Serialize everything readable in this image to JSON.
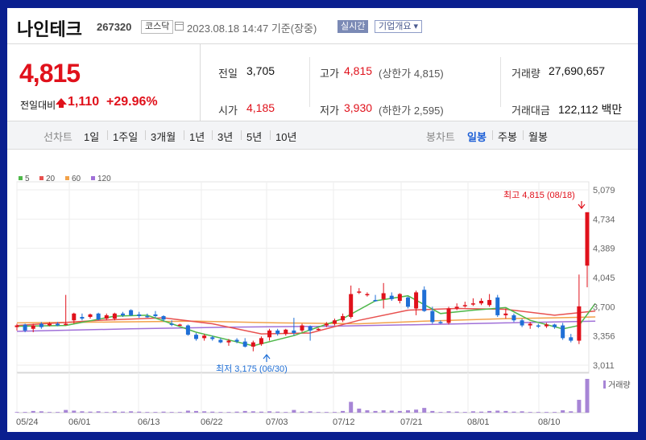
{
  "header": {
    "name": "나인테크",
    "code": "267320",
    "market": "코스닥",
    "datetime": "2023.08.18 14:47 기준(장중)",
    "realtime": "실시간",
    "overview": "기업개요 ▾"
  },
  "quote": {
    "price": "4,815",
    "change_label": "전일대비",
    "change": "1,110",
    "change_pct": "+29.96%",
    "prev_close_label": "전일",
    "prev_close": "3,705",
    "open_label": "시가",
    "open": "4,185",
    "high_label": "고가",
    "high": "4,815",
    "upper_limit": "(상한가 4,815)",
    "low_label": "저가",
    "low": "3,930",
    "lower_limit": "(하한가 2,595)",
    "volume_label": "거래량",
    "volume": "27,690,657",
    "amount_label": "거래대금",
    "amount": "122,112 백만"
  },
  "period_tabs": {
    "line_chart": "선차트",
    "items": [
      "1일",
      "1주일",
      "3개월",
      "1년",
      "3년",
      "5년",
      "10년"
    ],
    "candle_chart": "봉차트",
    "candle_items": [
      "일봉",
      "주봉",
      "월봉"
    ],
    "active": "일봉"
  },
  "colors": {
    "up": "#e0111b",
    "down": "#1f6fd6",
    "ma5": "#4fb84a",
    "ma20": "#e8514f",
    "ma60": "#f2a24a",
    "ma120": "#a070d8"
  },
  "chart_data": {
    "type": "candlestick",
    "legend": [
      {
        "name": "5",
        "color": "#4fb84a"
      },
      {
        "name": "20",
        "color": "#e8514f"
      },
      {
        "name": "60",
        "color": "#f2a24a"
      },
      {
        "name": "120",
        "color": "#a070d8"
      }
    ],
    "y_ticks": [
      "5,079",
      "4,734",
      "4,389",
      "4,045",
      "3,700",
      "3,356",
      "3,011"
    ],
    "ylim": [
      3011,
      5079
    ],
    "x_ticks": [
      "05/24",
      "06/01",
      "06/13",
      "06/22",
      "07/03",
      "07/12",
      "07/21",
      "08/01",
      "08/10"
    ],
    "volume_label": "거래량",
    "annotations": {
      "high": "최고 4,815 (08/18)",
      "low": "최저 3,175 (06/30)"
    },
    "candles": [
      {
        "o": 3460,
        "h": 3500,
        "l": 3420,
        "c": 3480,
        "v": 0.02
      },
      {
        "o": 3490,
        "h": 3500,
        "l": 3400,
        "c": 3420,
        "v": 0.02
      },
      {
        "o": 3440,
        "h": 3500,
        "l": 3400,
        "c": 3480,
        "v": 0.05
      },
      {
        "o": 3500,
        "h": 3520,
        "l": 3440,
        "c": 3460,
        "v": 0.04
      },
      {
        "o": 3480,
        "h": 3520,
        "l": 3470,
        "c": 3500,
        "v": 0.02
      },
      {
        "o": 3500,
        "h": 3520,
        "l": 3470,
        "c": 3480,
        "v": 0.02
      },
      {
        "o": 3490,
        "h": 3840,
        "l": 3480,
        "c": 3500,
        "v": 0.08
      },
      {
        "o": 3540,
        "h": 3630,
        "l": 3500,
        "c": 3620,
        "v": 0.06
      },
      {
        "o": 3580,
        "h": 3620,
        "l": 3540,
        "c": 3560,
        "v": 0.04
      },
      {
        "o": 3580,
        "h": 3620,
        "l": 3560,
        "c": 3610,
        "v": 0.03
      },
      {
        "o": 3620,
        "h": 3630,
        "l": 3540,
        "c": 3550,
        "v": 0.04
      },
      {
        "o": 3560,
        "h": 3620,
        "l": 3540,
        "c": 3600,
        "v": 0.02
      },
      {
        "o": 3560,
        "h": 3630,
        "l": 3540,
        "c": 3620,
        "v": 0.04
      },
      {
        "o": 3620,
        "h": 3640,
        "l": 3580,
        "c": 3600,
        "v": 0.03
      },
      {
        "o": 3660,
        "h": 3670,
        "l": 3590,
        "c": 3600,
        "v": 0.04
      },
      {
        "o": 3610,
        "h": 3640,
        "l": 3570,
        "c": 3590,
        "v": 0.03
      },
      {
        "o": 3590,
        "h": 3620,
        "l": 3570,
        "c": 3580,
        "v": 0.02
      },
      {
        "o": 3610,
        "h": 3650,
        "l": 3570,
        "c": 3590,
        "v": 0.02
      },
      {
        "o": 3590,
        "h": 3600,
        "l": 3530,
        "c": 3550,
        "v": 0.03
      },
      {
        "o": 3500,
        "h": 3540,
        "l": 3470,
        "c": 3490,
        "v": 0.02
      },
      {
        "o": 3490,
        "h": 3500,
        "l": 3480,
        "c": 3490,
        "v": 0.02
      },
      {
        "o": 3480,
        "h": 3490,
        "l": 3360,
        "c": 3370,
        "v": 0.06
      },
      {
        "o": 3370,
        "h": 3390,
        "l": 3300,
        "c": 3320,
        "v": 0.05
      },
      {
        "o": 3330,
        "h": 3380,
        "l": 3300,
        "c": 3360,
        "v": 0.04
      },
      {
        "o": 3340,
        "h": 3360,
        "l": 3300,
        "c": 3320,
        "v": 0.03
      },
      {
        "o": 3310,
        "h": 3330,
        "l": 3270,
        "c": 3280,
        "v": 0.02
      },
      {
        "o": 3280,
        "h": 3320,
        "l": 3240,
        "c": 3300,
        "v": 0.02
      },
      {
        "o": 3310,
        "h": 3330,
        "l": 3270,
        "c": 3290,
        "v": 0.03
      },
      {
        "o": 3290,
        "h": 3330,
        "l": 3220,
        "c": 3230,
        "v": 0.05
      },
      {
        "o": 3230,
        "h": 3300,
        "l": 3175,
        "c": 3280,
        "v": 0.04
      },
      {
        "o": 3260,
        "h": 3350,
        "l": 3240,
        "c": 3330,
        "v": 0.03
      },
      {
        "o": 3340,
        "h": 3440,
        "l": 3300,
        "c": 3420,
        "v": 0.04
      },
      {
        "o": 3420,
        "h": 3440,
        "l": 3360,
        "c": 3380,
        "v": 0.03
      },
      {
        "o": 3380,
        "h": 3440,
        "l": 3360,
        "c": 3430,
        "v": 0.02
      },
      {
        "o": 3420,
        "h": 3570,
        "l": 3360,
        "c": 3390,
        "v": 0.08
      },
      {
        "o": 3420,
        "h": 3500,
        "l": 3400,
        "c": 3480,
        "v": 0.03
      },
      {
        "o": 3470,
        "h": 3480,
        "l": 3300,
        "c": 3420,
        "v": 0.04
      },
      {
        "o": 3430,
        "h": 3450,
        "l": 3420,
        "c": 3440,
        "v": 0.02
      },
      {
        "o": 3480,
        "h": 3520,
        "l": 3460,
        "c": 3500,
        "v": 0.02
      },
      {
        "o": 3500,
        "h": 3560,
        "l": 3480,
        "c": 3540,
        "v": 0.02
      },
      {
        "o": 3540,
        "h": 3620,
        "l": 3520,
        "c": 3590,
        "v": 0.05
      },
      {
        "o": 3580,
        "h": 3950,
        "l": 3560,
        "c": 3850,
        "v": 0.32
      },
      {
        "o": 3870,
        "h": 3920,
        "l": 3850,
        "c": 3880,
        "v": 0.12
      },
      {
        "o": 3840,
        "h": 3870,
        "l": 3820,
        "c": 3850,
        "v": 0.07
      },
      {
        "o": 3780,
        "h": 3840,
        "l": 3760,
        "c": 3770,
        "v": 0.05
      },
      {
        "o": 3790,
        "h": 3980,
        "l": 3680,
        "c": 3860,
        "v": 0.07
      },
      {
        "o": 3830,
        "h": 3870,
        "l": 3770,
        "c": 3790,
        "v": 0.06
      },
      {
        "o": 3770,
        "h": 3860,
        "l": 3740,
        "c": 3850,
        "v": 0.05
      },
      {
        "o": 3810,
        "h": 3820,
        "l": 3680,
        "c": 3700,
        "v": 0.07
      },
      {
        "o": 3680,
        "h": 3890,
        "l": 3600,
        "c": 3870,
        "v": 0.09
      },
      {
        "o": 3900,
        "h": 3940,
        "l": 3640,
        "c": 3650,
        "v": 0.14
      },
      {
        "o": 3650,
        "h": 3700,
        "l": 3500,
        "c": 3520,
        "v": 0.05
      },
      {
        "o": 3520,
        "h": 3540,
        "l": 3500,
        "c": 3510,
        "v": 0.02
      },
      {
        "o": 3510,
        "h": 3700,
        "l": 3490,
        "c": 3680,
        "v": 0.04
      },
      {
        "o": 3680,
        "h": 3740,
        "l": 3660,
        "c": 3700,
        "v": 0.03
      },
      {
        "o": 3720,
        "h": 3760,
        "l": 3690,
        "c": 3720,
        "v": 0.02
      },
      {
        "o": 3730,
        "h": 3800,
        "l": 3710,
        "c": 3740,
        "v": 0.04
      },
      {
        "o": 3740,
        "h": 3800,
        "l": 3720,
        "c": 3770,
        "v": 0.03
      },
      {
        "o": 3720,
        "h": 3850,
        "l": 3700,
        "c": 3780,
        "v": 0.05
      },
      {
        "o": 3810,
        "h": 3840,
        "l": 3580,
        "c": 3600,
        "v": 0.06
      },
      {
        "o": 3600,
        "h": 3680,
        "l": 3560,
        "c": 3620,
        "v": 0.05
      },
      {
        "o": 3600,
        "h": 3620,
        "l": 3520,
        "c": 3540,
        "v": 0.03
      },
      {
        "o": 3540,
        "h": 3560,
        "l": 3460,
        "c": 3480,
        "v": 0.04
      },
      {
        "o": 3480,
        "h": 3520,
        "l": 3440,
        "c": 3500,
        "v": 0.02
      },
      {
        "o": 3480,
        "h": 3500,
        "l": 3450,
        "c": 3470,
        "v": 0.02
      },
      {
        "o": 3470,
        "h": 3510,
        "l": 3450,
        "c": 3490,
        "v": 0.02
      },
      {
        "o": 3490,
        "h": 3500,
        "l": 3440,
        "c": 3460,
        "v": 0.02
      },
      {
        "o": 3480,
        "h": 3510,
        "l": 3310,
        "c": 3330,
        "v": 0.07
      },
      {
        "o": 3340,
        "h": 3380,
        "l": 3280,
        "c": 3300,
        "v": 0.04
      },
      {
        "o": 3300,
        "h": 4080,
        "l": 3260,
        "c": 3705,
        "v": 0.38
      },
      {
        "o": 4185,
        "h": 4815,
        "l": 3930,
        "c": 4815,
        "v": 1.0
      }
    ],
    "ma5": [
      [
        0,
        3470
      ],
      [
        6,
        3480
      ],
      [
        12,
        3590
      ],
      [
        16,
        3600
      ],
      [
        22,
        3400
      ],
      [
        29,
        3240
      ],
      [
        34,
        3360
      ],
      [
        40,
        3560
      ],
      [
        44,
        3770
      ],
      [
        48,
        3830
      ],
      [
        52,
        3620
      ],
      [
        56,
        3660
      ],
      [
        60,
        3690
      ],
      [
        63,
        3540
      ],
      [
        67,
        3440
      ],
      [
        69,
        3480
      ],
      [
        71,
        3740
      ]
    ],
    "ma20": [
      [
        0,
        3480
      ],
      [
        10,
        3540
      ],
      [
        18,
        3570
      ],
      [
        24,
        3500
      ],
      [
        30,
        3380
      ],
      [
        36,
        3390
      ],
      [
        42,
        3540
      ],
      [
        48,
        3660
      ],
      [
        54,
        3680
      ],
      [
        60,
        3670
      ],
      [
        66,
        3600
      ],
      [
        71,
        3650
      ]
    ],
    "ma60": [
      [
        0,
        3510
      ],
      [
        12,
        3520
      ],
      [
        22,
        3530
      ],
      [
        32,
        3510
      ],
      [
        42,
        3500
      ],
      [
        50,
        3530
      ],
      [
        60,
        3560
      ],
      [
        66,
        3570
      ],
      [
        71,
        3580
      ]
    ],
    "ma120": [
      [
        0,
        3410
      ],
      [
        14,
        3440
      ],
      [
        26,
        3460
      ],
      [
        38,
        3470
      ],
      [
        50,
        3490
      ],
      [
        60,
        3510
      ],
      [
        71,
        3530
      ]
    ]
  }
}
